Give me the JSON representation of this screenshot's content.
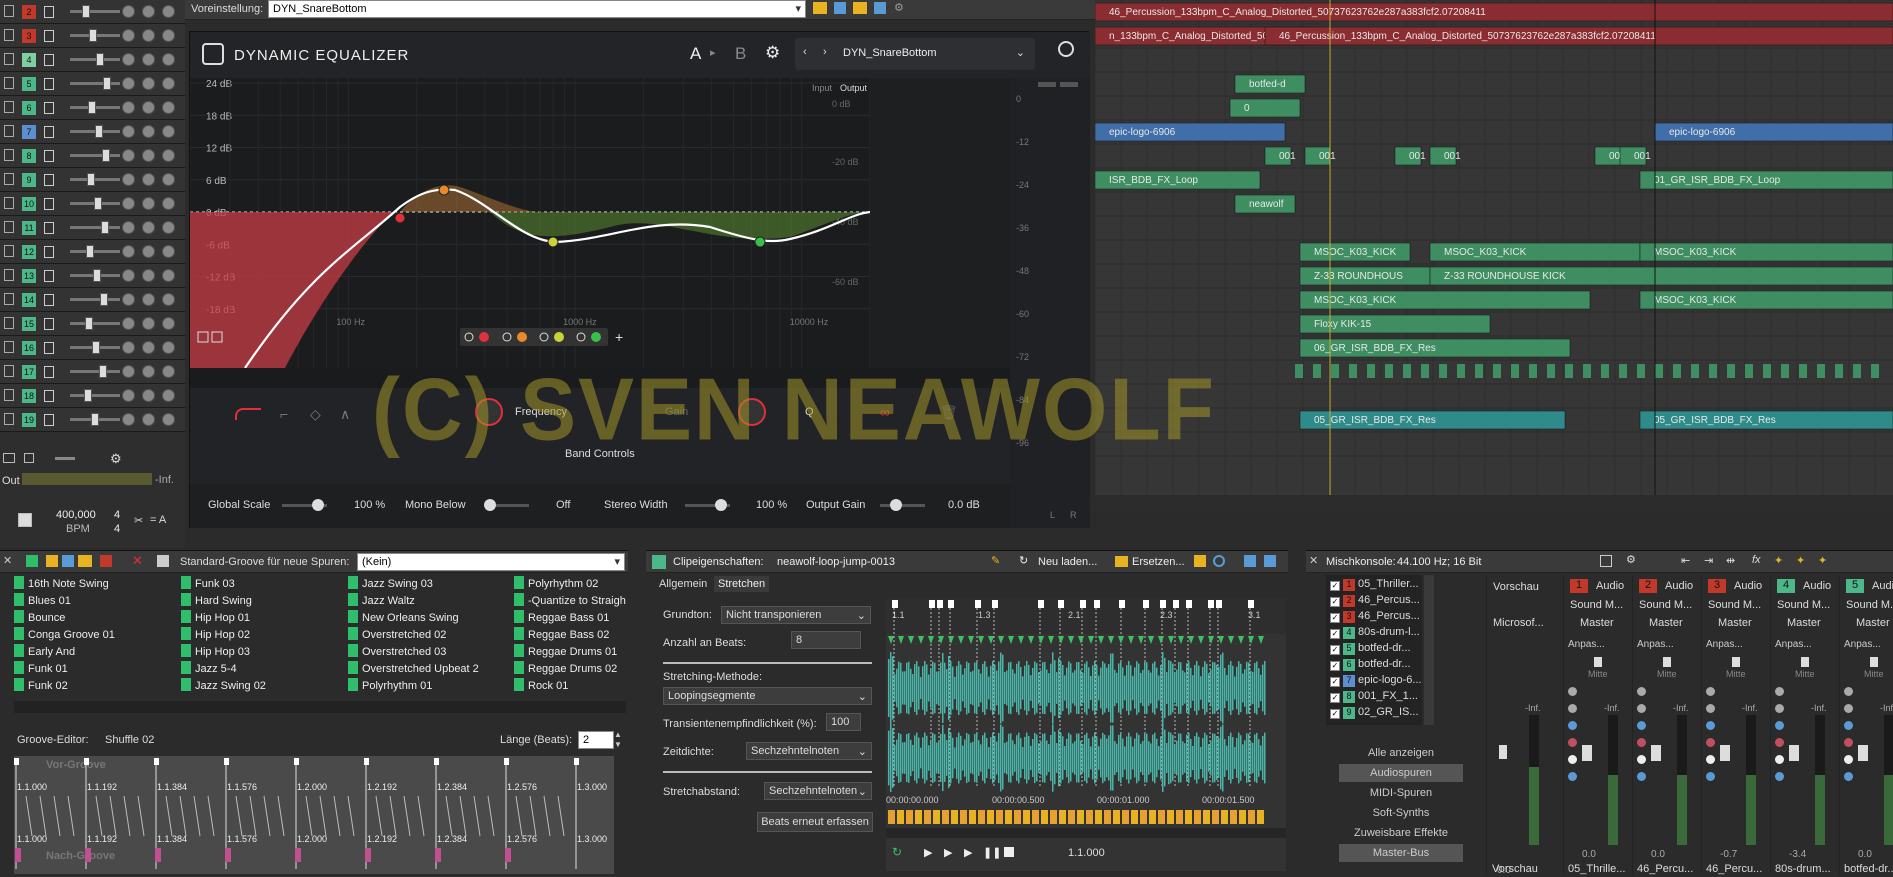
{
  "preset_bar": {
    "label": "Voreinstellung:",
    "value": "DYN_SnareBottom"
  },
  "plugin": {
    "name": "DYNAMIC EQUALIZER",
    "ab_a": "A",
    "ab_b": "B",
    "preset": "DYN_SnareBottom",
    "db_labels": [
      "24 dB",
      "18 dB",
      "12 dB",
      "6 dB",
      "0 dB",
      "-6 dB",
      "-12 dB",
      "-18 dB"
    ],
    "out_labels": [
      "0 dB",
      "-20 dB",
      "-40 dB",
      "-60 dB"
    ],
    "meter_labels": [
      "0",
      "-12",
      "-24",
      "-36",
      "-48",
      "-60",
      "-72",
      "-84",
      "-96"
    ],
    "freq_labels": [
      "100 Hz",
      "1000 Hz",
      "10000 Hz"
    ],
    "io_input": "Input",
    "io_output": "Output",
    "band_controls": {
      "frequency": "Frequency",
      "gain": "Gain",
      "q": "Q"
    },
    "band_controls_title": "Band Controls",
    "global_scale": {
      "label": "Global Scale",
      "value": "100 %"
    },
    "mono_below": {
      "label": "Mono Below",
      "value": "Off"
    },
    "stereo_width": {
      "label": "Stereo Width",
      "value": "100 %"
    },
    "output_gain": {
      "label": "Output Gain",
      "value": "0.0 dB"
    },
    "meter_lr": [
      "L",
      "R"
    ],
    "band_colors": [
      "#e0303a",
      "#e88a2a",
      "#c8d43a",
      "#3abf4a"
    ]
  },
  "left_tracks": {
    "numbers": [
      "2",
      "3",
      "4",
      "5",
      "6",
      "7",
      "8",
      "9",
      "10",
      "11",
      "12",
      "13",
      "14",
      "15",
      "16",
      "17",
      "18",
      "19"
    ],
    "colors": [
      "#c0392b",
      "#c0392b",
      "#7fd0a0",
      "#4cb88a",
      "#4cb88a",
      "#5b8fd0",
      "#4cb88a",
      "#4cb88a",
      "#4cb88a",
      "#4cb88a",
      "#4cb88a",
      "#4cb88a",
      "#4cb88a",
      "#4cb88a",
      "#4cb88a",
      "#4cb88a",
      "#4cb88a",
      "#4cb88a"
    ]
  },
  "transport_left": {
    "out": "Out",
    "out_value": "-Inf.",
    "bpm": "400,000",
    "bpm_label": "BPM",
    "time_sig_top": "4",
    "time_sig_bottom": "4",
    "snap": "= A"
  },
  "arrangement": {
    "clips": [
      {
        "label": "46_Percussion_133bpm_C_Analog_Distorted_50737623762e287a383fcf2.07208411",
        "color": "red"
      },
      {
        "label": "n_133bpm_C_Analog_Distorted_50",
        "color": "red"
      },
      {
        "label": "46_Percussion_133bpm_C_Analog_Distorted_50737623762e287a383fcf2.07208411",
        "color": "red"
      },
      {
        "label": "botfed-d",
        "color": "green"
      },
      {
        "label": "0",
        "color": "green"
      },
      {
        "label": "epic-logo-6906",
        "color": "blue"
      },
      {
        "label": "epic-logo-6906",
        "color": "blue"
      },
      {
        "label": "001",
        "color": "green"
      },
      {
        "label": "001",
        "color": "green"
      },
      {
        "label": "001",
        "color": "green"
      },
      {
        "label": "001",
        "color": "green"
      },
      {
        "label": "001",
        "color": "green"
      },
      {
        "label": "001",
        "color": "green"
      },
      {
        "label": "ISR_BDB_FX_Loop",
        "color": "green"
      },
      {
        "label": "01_GR_ISR_BDB_FX_Loop",
        "color": "green"
      },
      {
        "label": "neawolf",
        "color": "green"
      },
      {
        "label": "MSOC_K03_KICK",
        "color": "green"
      },
      {
        "label": "MSOC_K03_KICK",
        "color": "green"
      },
      {
        "label": "MSOC_K03_KICK",
        "color": "green"
      },
      {
        "label": "Z-33 ROUNDHOUS",
        "color": "green"
      },
      {
        "label": "Z-33 ROUNDHOUSE KICK",
        "color": "green"
      },
      {
        "label": "MSOC_K03_KICK",
        "color": "green"
      },
      {
        "label": "MSOC_K03_KICK",
        "color": "green"
      },
      {
        "label": "Floxy KIK-15",
        "color": "green"
      },
      {
        "label": "06_GR_ISR_BDB_FX_Res",
        "color": "green"
      },
      {
        "label": "05_GR_ISR_BDB_FX_Res",
        "color": "teal"
      },
      {
        "label": "05_GR_ISR_BDB_FX_Res",
        "color": "teal"
      }
    ]
  },
  "watermark": "(C) SVEN NEAWOLF",
  "groove": {
    "label": "Standard-Groove für neue Spuren:",
    "value": "(Kein)",
    "columns": [
      [
        "16th Note Swing",
        "Blues 01",
        "Bounce",
        "Conga Groove 01",
        "Early And",
        "Funk 01",
        "Funk 02"
      ],
      [
        "Funk 03",
        "Hard Swing",
        "Hip Hop 01",
        "Hip Hop 02",
        "Hip Hop 03",
        "Jazz 5-4",
        "Jazz Swing 02"
      ],
      [
        "Jazz Swing 03",
        "Jazz Waltz",
        "New Orleans Swing",
        "Overstretched 02",
        "Overstretched 03",
        "Overstretched Upbeat 2",
        "Polyrhythm 01"
      ],
      [
        "Polyrhythm 02",
        "-Quantize to Straigh",
        "Reggae Bass 01",
        "Reggae Bass 02",
        "Reggae Drums 01",
        "Reggae Drums 02",
        "Rock 01"
      ]
    ],
    "editor_label": "Groove-Editor:",
    "editor_value": "Shuffle 02",
    "length_label": "Länge (Beats):",
    "length_value": "2",
    "vor": "Vor-Groove",
    "nach": "Nach-Groove",
    "top_ticks": [
      "1.1.000",
      "1.1.192",
      "1.1.384",
      "1.1.576",
      "1.2.000",
      "1.2.192",
      "1.2.384",
      "1.2.576",
      "1.3.000"
    ],
    "bot_ticks": [
      "1.1.000",
      "1.1.192",
      "1.1.384",
      "1.1.576",
      "1.2.000",
      "1.2.192",
      "1.2.384",
      "1.2.576",
      "1.3.000"
    ]
  },
  "clip": {
    "title": "Clipeigenschaften:",
    "clip_name": "neawolf-loop-jump-0013",
    "reload": "Neu laden...",
    "replace": "Ersetzen...",
    "tabs": [
      "Allgemein",
      "Stretchen"
    ],
    "grundton_label": "Grundton:",
    "grundton_value": "Nicht transponieren",
    "beats_label": "Anzahl an Beats:",
    "beats_value": "8",
    "method_label": "Stretching-Methode:",
    "method_value": "Loopingsegmente",
    "trans_label": "Transientenempfindlichkeit (%):",
    "trans_value": "100",
    "zeit_label": "Zeitdichte:",
    "zeit_value": "Sechzehntelnoten",
    "abstand_label": "Stretchabstand:",
    "abstand_value": "Sechzehntelnoten",
    "beats_btn": "Beats erneut erfassen",
    "ruler": [
      "1.1",
      "1.3",
      "2.1",
      "2.3",
      "3.1"
    ],
    "time_ruler": [
      "00:00:00.000",
      "00:00:00.500",
      "00:00:01.000",
      "00:00:01.500"
    ],
    "position": "1.1.000"
  },
  "mixer": {
    "title": "Mischkonsole:",
    "format": "44.100 Hz; 16 Bit",
    "tracks": [
      {
        "n": "1",
        "label": "05_Thriller..."
      },
      {
        "n": "2",
        "label": "46_Percus..."
      },
      {
        "n": "3",
        "label": "46_Percus..."
      },
      {
        "n": "4",
        "label": "80s-drum-l..."
      },
      {
        "n": "5",
        "label": "botfed-dr..."
      },
      {
        "n": "6",
        "label": "botfed-dr..."
      },
      {
        "n": "7",
        "label": "epic-logo-6..."
      },
      {
        "n": "8",
        "label": "001_FX_1..."
      },
      {
        "n": "9",
        "label": "02_GR_IS..."
      }
    ],
    "filter_buttons": [
      "Alle anzeigen",
      "Audiospuren",
      "MIDI-Spuren",
      "Soft-Synths",
      "Zuweisbare Effekte",
      "Master-Bus"
    ],
    "vorschau": "Vorschau",
    "microsoft": "Microsof...",
    "channels": [
      {
        "n": "1",
        "type": "Audio",
        "dev": "Sound M...",
        "out": "Master",
        "pan": "Mitte",
        "val": "0.0",
        "name": "05_Thrille..."
      },
      {
        "n": "2",
        "type": "Audio",
        "dev": "Sound M...",
        "out": "Master",
        "pan": "Mitte",
        "val": "0.0",
        "name": "46_Percu..."
      },
      {
        "n": "3",
        "type": "Audio",
        "dev": "Sound M...",
        "out": "Master",
        "pan": "Mitte",
        "val": "-0.7",
        "name": "46_Percu..."
      },
      {
        "n": "4",
        "type": "Audio",
        "dev": "Sound M...",
        "out": "Master",
        "pan": "Mitte",
        "val": "-3.4",
        "name": "80s-drum..."
      },
      {
        "n": "5",
        "type": "Audio",
        "dev": "Sound M...",
        "out": "Master",
        "pan": "Mitte",
        "val": "0.0",
        "name": "botfed-dr..."
      }
    ],
    "anpas": "Anpas...",
    "inf": "-Inf.",
    "vorschau_val": "0.0",
    "vorschau_bottom": "Vorschau"
  }
}
